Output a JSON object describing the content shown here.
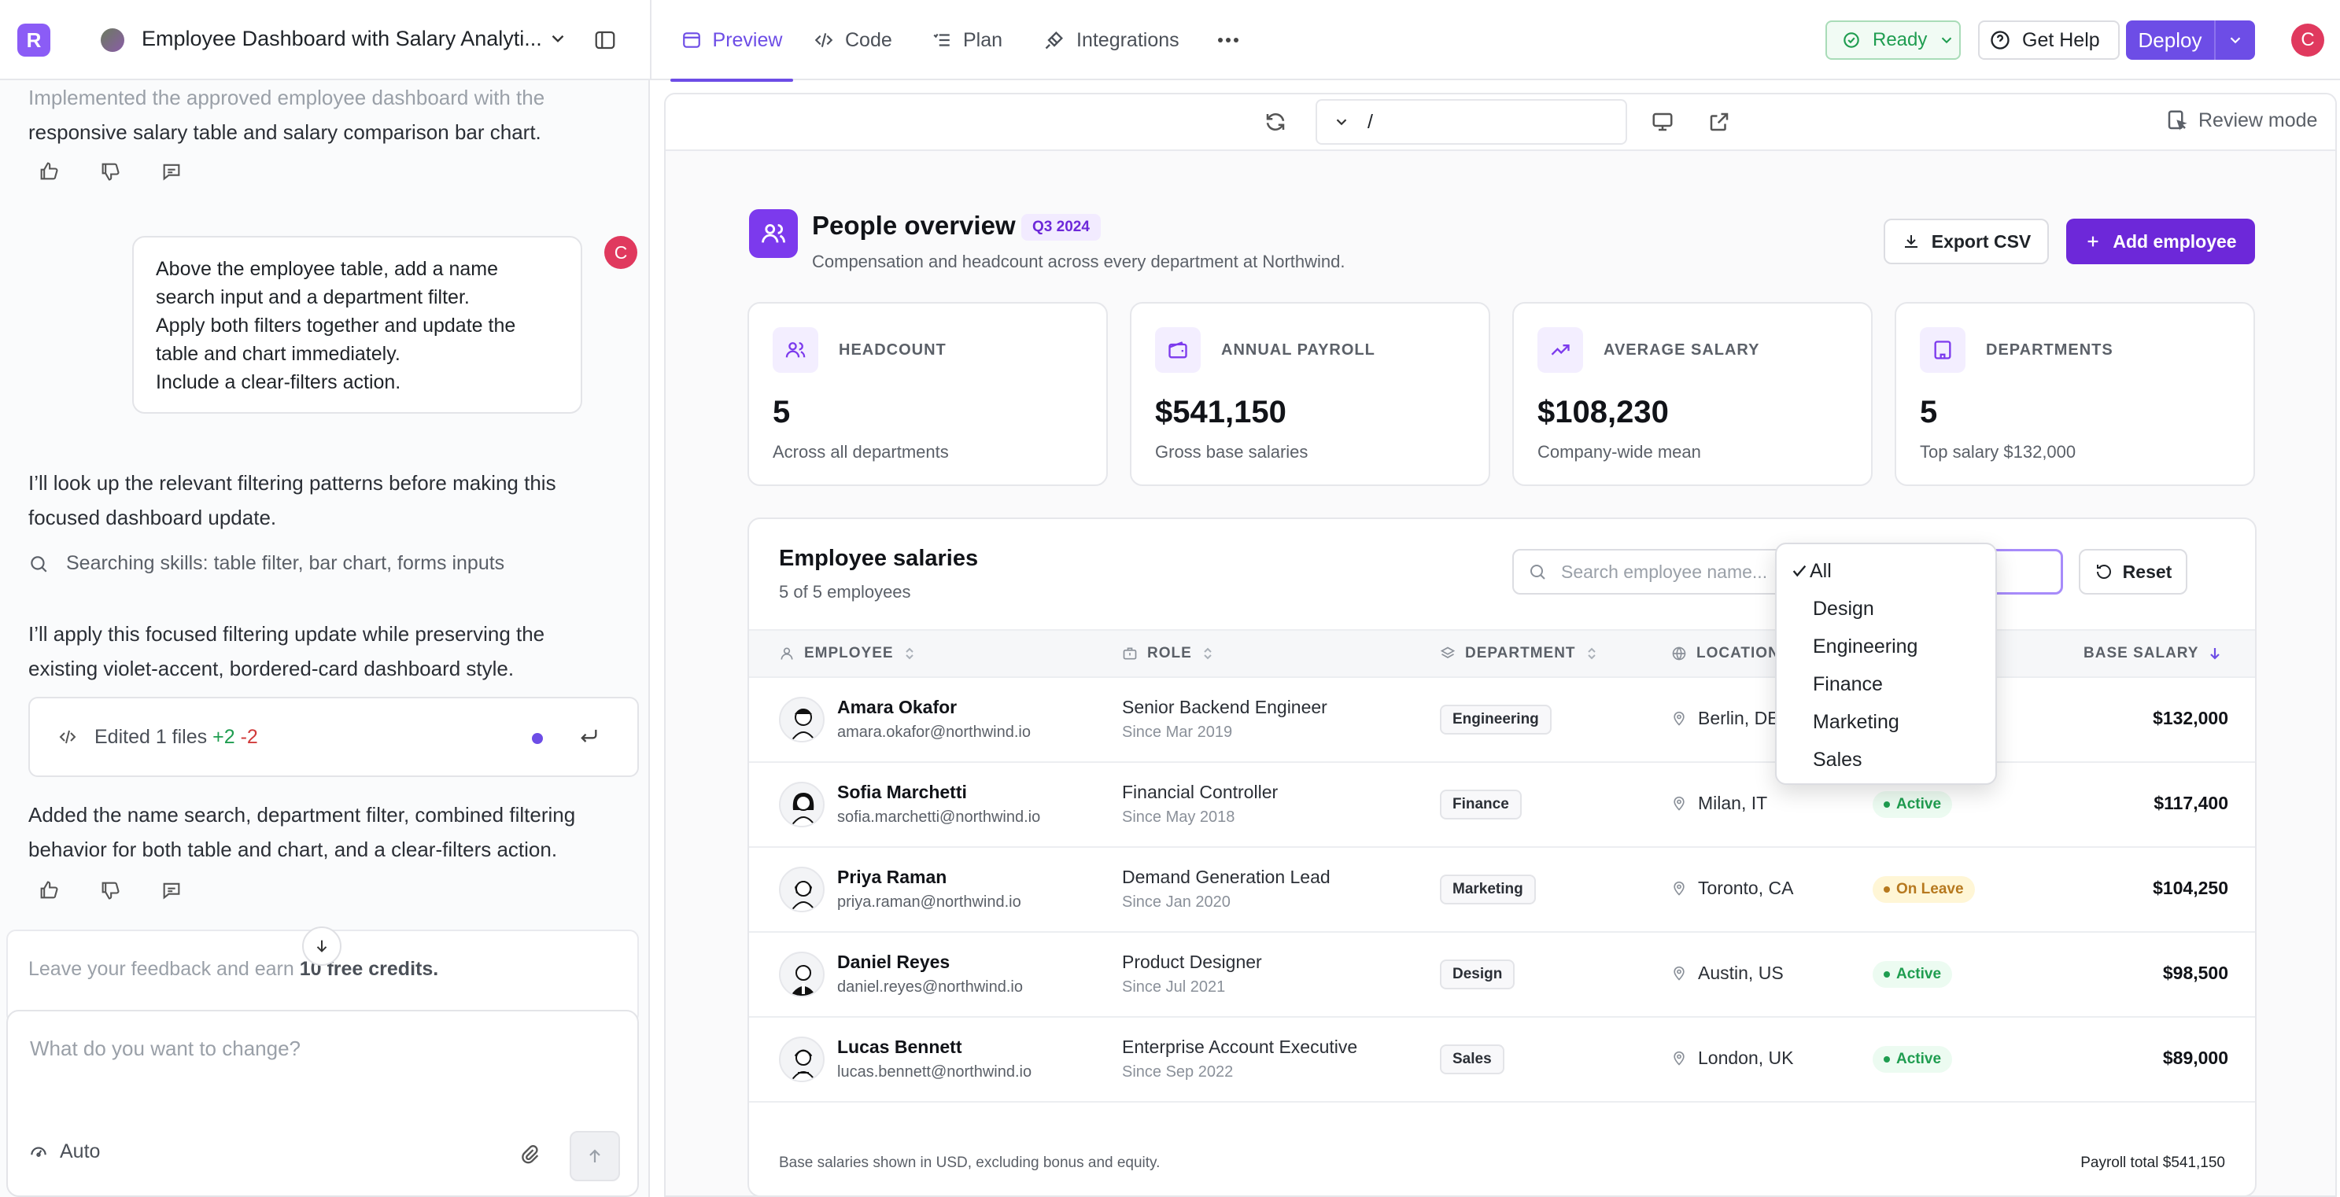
{
  "topbar": {
    "project_title": "Employee Dashboard with Salary Analyti...",
    "tabs": [
      {
        "label": "Preview"
      },
      {
        "label": "Code"
      },
      {
        "label": "Plan"
      },
      {
        "label": "Integrations"
      }
    ],
    "ready_label": "Ready",
    "help_label": "Get Help",
    "deploy_label": "Deploy",
    "avatar_initial": "C",
    "logo_letter": "R",
    "accent_color": "#6d4de6"
  },
  "chat": {
    "prev_msg": "Implemented the approved employee dashboard with the responsive salary table and salary comparison bar chart.",
    "prev_msg_line1": "Implemented the approved employee dashboard with the",
    "prev_msg_line2": "responsive salary table and salary comparison bar chart.",
    "user_avatar_initial": "C",
    "user_msg_lines": [
      "Above the employee table, add a name",
      "search input and a department filter.",
      "Apply both filters together and update the",
      "table and chart immediately.",
      "Include a clear-filters action."
    ],
    "reply_1_line1": "I’ll look up the relevant filtering patterns before making this",
    "reply_1_line2": "focused dashboard update.",
    "search_skills": "Searching skills: table filter, bar chart, forms inputs",
    "reply_2_line1": "I’ll apply this focused filtering update while preserving the",
    "reply_2_line2": "existing violet-accent, bordered-card dashboard style.",
    "edited_label": "Edited 1 files",
    "edited_plus": "+2",
    "edited_minus": "-2",
    "reply_3_line1": "Added the name search, department filter, combined filtering",
    "reply_3_line2": "behavior for both table and chart, and a clear-filters action.",
    "credits_prefix": "Leave your feedback and earn",
    "credits_bold": "10 free credits.",
    "composer_placeholder": "What do you want to change?",
    "mode_label": "Auto"
  },
  "preview": {
    "url_path": "/",
    "review_label": "Review mode"
  },
  "app": {
    "title": "People overview",
    "badge": "Q3 2024",
    "subtitle": "Compensation and headcount across every department at Northwind.",
    "export_label": "Export CSV",
    "add_label": "Add employee",
    "kpis": [
      {
        "label": "HEADCOUNT",
        "value": "5",
        "sub": "Across all departments"
      },
      {
        "label": "ANNUAL PAYROLL",
        "value": "$541,150",
        "sub": "Gross base salaries"
      },
      {
        "label": "AVERAGE SALARY",
        "value": "$108,230",
        "sub": "Company-wide mean"
      },
      {
        "label": "DEPARTMENTS",
        "value": "5",
        "sub": "Top salary $132,000"
      }
    ],
    "table": {
      "title": "Employee salaries",
      "count": "5 of 5 employees",
      "search_placeholder": "Search employee name...",
      "reset_label": "Reset",
      "columns": [
        "EMPLOYEE",
        "ROLE",
        "DEPARTMENT",
        "LOCATION",
        "BASE SALARY"
      ],
      "rows": [
        {
          "name": "Amara Okafor",
          "email": "amara.okafor@northwind.io",
          "role": "Senior Backend Engineer",
          "since": "Since Mar 2019",
          "dept": "Engineering",
          "location": "Berlin, DE",
          "status": "",
          "salary": "$132,000"
        },
        {
          "name": "Sofia Marchetti",
          "email": "sofia.marchetti@northwind.io",
          "role": "Financial Controller",
          "since": "Since May 2018",
          "dept": "Finance",
          "location": "Milan, IT",
          "status": "Active",
          "salary": "$117,400"
        },
        {
          "name": "Priya Raman",
          "email": "priya.raman@northwind.io",
          "role": "Demand Generation Lead",
          "since": "Since Jan 2020",
          "dept": "Marketing",
          "location": "Toronto, CA",
          "status": "On Leave",
          "salary": "$104,250"
        },
        {
          "name": "Daniel Reyes",
          "email": "daniel.reyes@northwind.io",
          "role": "Product Designer",
          "since": "Since Jul 2021",
          "dept": "Design",
          "location": "Austin, US",
          "status": "Active",
          "salary": "$98,500"
        },
        {
          "name": "Lucas Bennett",
          "email": "lucas.bennett@northwind.io",
          "role": "Enterprise Account Executive",
          "since": "Since Sep 2022",
          "dept": "Sales",
          "location": "London, UK",
          "status": "Active",
          "salary": "$89,000"
        }
      ],
      "footer_note": "Base salaries shown in USD, excluding bonus and equity.",
      "footer_total": "Payroll total $541,150"
    },
    "dept_dropdown": {
      "selected": "All",
      "options": [
        "All",
        "Design",
        "Engineering",
        "Finance",
        "Marketing",
        "Sales"
      ]
    }
  }
}
